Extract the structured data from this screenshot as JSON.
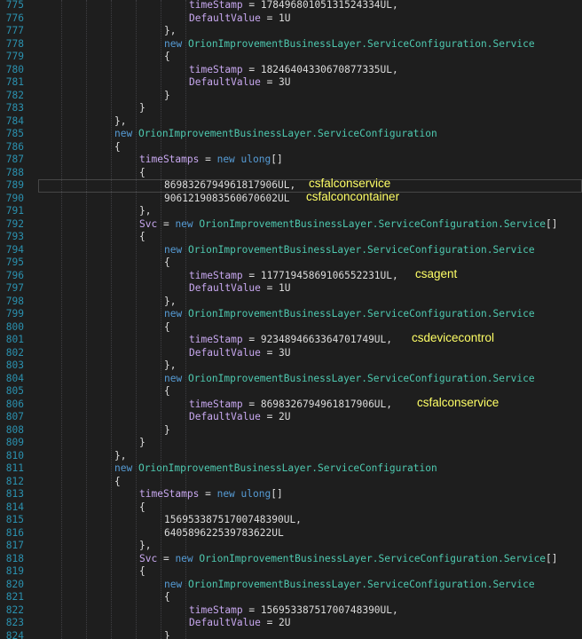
{
  "editor": {
    "lines": [
      {
        "no": "775",
        "indent": 6,
        "tokens": [
          {
            "t": "timeStamp",
            "c": "f"
          },
          {
            "t": " = 17849680105131524334UL,",
            "c": "p"
          }
        ]
      },
      {
        "no": "776",
        "indent": 6,
        "tokens": [
          {
            "t": "DefaultValue",
            "c": "f"
          },
          {
            "t": " = 1U",
            "c": "p"
          }
        ]
      },
      {
        "no": "777",
        "indent": 5,
        "tokens": [
          {
            "t": "},",
            "c": "p"
          }
        ]
      },
      {
        "no": "778",
        "indent": 5,
        "tokens": [
          {
            "t": "new ",
            "c": "k"
          },
          {
            "t": "OrionImprovementBusinessLayer.ServiceConfiguration.Service",
            "c": "t"
          }
        ]
      },
      {
        "no": "779",
        "indent": 5,
        "tokens": [
          {
            "t": "{",
            "c": "p"
          }
        ]
      },
      {
        "no": "780",
        "indent": 6,
        "tokens": [
          {
            "t": "timeStamp",
            "c": "f"
          },
          {
            "t": " = 18246404330670877335UL,",
            "c": "p"
          }
        ]
      },
      {
        "no": "781",
        "indent": 6,
        "tokens": [
          {
            "t": "DefaultValue",
            "c": "f"
          },
          {
            "t": " = 3U",
            "c": "p"
          }
        ]
      },
      {
        "no": "782",
        "indent": 5,
        "tokens": [
          {
            "t": "}",
            "c": "p"
          }
        ]
      },
      {
        "no": "783",
        "indent": 4,
        "tokens": [
          {
            "t": "}",
            "c": "p"
          }
        ]
      },
      {
        "no": "784",
        "indent": 3,
        "tokens": [
          {
            "t": "},",
            "c": "p"
          }
        ]
      },
      {
        "no": "785",
        "indent": 3,
        "tokens": [
          {
            "t": "new ",
            "c": "k"
          },
          {
            "t": "OrionImprovementBusinessLayer.ServiceConfiguration",
            "c": "t"
          }
        ]
      },
      {
        "no": "786",
        "indent": 3,
        "tokens": [
          {
            "t": "{",
            "c": "p"
          }
        ]
      },
      {
        "no": "787",
        "indent": 4,
        "tokens": [
          {
            "t": "timeStamps",
            "c": "f"
          },
          {
            "t": " = ",
            "c": "p"
          },
          {
            "t": "new ",
            "c": "k"
          },
          {
            "t": "ulong",
            "c": "k"
          },
          {
            "t": "[]",
            "c": "p"
          }
        ]
      },
      {
        "no": "788",
        "indent": 4,
        "tokens": [
          {
            "t": "{",
            "c": "p"
          }
        ]
      },
      {
        "no": "789",
        "indent": 5,
        "tokens": [
          {
            "t": "8698326794961817906UL,",
            "c": "p"
          }
        ]
      },
      {
        "no": "790",
        "indent": 5,
        "tokens": [
          {
            "t": "9061219083560670602UL",
            "c": "p"
          }
        ]
      },
      {
        "no": "791",
        "indent": 4,
        "tokens": [
          {
            "t": "},",
            "c": "p"
          }
        ]
      },
      {
        "no": "792",
        "indent": 4,
        "tokens": [
          {
            "t": "Svc",
            "c": "f"
          },
          {
            "t": " = ",
            "c": "p"
          },
          {
            "t": "new ",
            "c": "k"
          },
          {
            "t": "OrionImprovementBusinessLayer.ServiceConfiguration.Service",
            "c": "t"
          },
          {
            "t": "[]",
            "c": "p"
          }
        ]
      },
      {
        "no": "793",
        "indent": 4,
        "tokens": [
          {
            "t": "{",
            "c": "p"
          }
        ]
      },
      {
        "no": "794",
        "indent": 5,
        "tokens": [
          {
            "t": "new ",
            "c": "k"
          },
          {
            "t": "OrionImprovementBusinessLayer.ServiceConfiguration.Service",
            "c": "t"
          }
        ]
      },
      {
        "no": "795",
        "indent": 5,
        "tokens": [
          {
            "t": "{",
            "c": "p"
          }
        ]
      },
      {
        "no": "796",
        "indent": 6,
        "tokens": [
          {
            "t": "timeStamp",
            "c": "f"
          },
          {
            "t": " = 11771945869106552231UL,",
            "c": "p"
          }
        ]
      },
      {
        "no": "797",
        "indent": 6,
        "tokens": [
          {
            "t": "DefaultValue",
            "c": "f"
          },
          {
            "t": " = 1U",
            "c": "p"
          }
        ]
      },
      {
        "no": "798",
        "indent": 5,
        "tokens": [
          {
            "t": "},",
            "c": "p"
          }
        ]
      },
      {
        "no": "799",
        "indent": 5,
        "tokens": [
          {
            "t": "new ",
            "c": "k"
          },
          {
            "t": "OrionImprovementBusinessLayer.ServiceConfiguration.Service",
            "c": "t"
          }
        ]
      },
      {
        "no": "800",
        "indent": 5,
        "tokens": [
          {
            "t": "{",
            "c": "p"
          }
        ]
      },
      {
        "no": "801",
        "indent": 6,
        "tokens": [
          {
            "t": "timeStamp",
            "c": "f"
          },
          {
            "t": " = 9234894663364701749UL,",
            "c": "p"
          }
        ]
      },
      {
        "no": "802",
        "indent": 6,
        "tokens": [
          {
            "t": "DefaultValue",
            "c": "f"
          },
          {
            "t": " = 3U",
            "c": "p"
          }
        ]
      },
      {
        "no": "803",
        "indent": 5,
        "tokens": [
          {
            "t": "},",
            "c": "p"
          }
        ]
      },
      {
        "no": "804",
        "indent": 5,
        "tokens": [
          {
            "t": "new ",
            "c": "k"
          },
          {
            "t": "OrionImprovementBusinessLayer.ServiceConfiguration.Service",
            "c": "t"
          }
        ]
      },
      {
        "no": "805",
        "indent": 5,
        "tokens": [
          {
            "t": "{",
            "c": "p"
          }
        ]
      },
      {
        "no": "806",
        "indent": 6,
        "tokens": [
          {
            "t": "timeStamp",
            "c": "f"
          },
          {
            "t": " = 8698326794961817906UL,",
            "c": "p"
          }
        ]
      },
      {
        "no": "807",
        "indent": 6,
        "tokens": [
          {
            "t": "DefaultValue",
            "c": "f"
          },
          {
            "t": " = 2U",
            "c": "p"
          }
        ]
      },
      {
        "no": "808",
        "indent": 5,
        "tokens": [
          {
            "t": "}",
            "c": "p"
          }
        ]
      },
      {
        "no": "809",
        "indent": 4,
        "tokens": [
          {
            "t": "}",
            "c": "p"
          }
        ]
      },
      {
        "no": "810",
        "indent": 3,
        "tokens": [
          {
            "t": "},",
            "c": "p"
          }
        ]
      },
      {
        "no": "811",
        "indent": 3,
        "tokens": [
          {
            "t": "new ",
            "c": "k"
          },
          {
            "t": "OrionImprovementBusinessLayer.ServiceConfiguration",
            "c": "t"
          }
        ]
      },
      {
        "no": "812",
        "indent": 3,
        "tokens": [
          {
            "t": "{",
            "c": "p"
          }
        ]
      },
      {
        "no": "813",
        "indent": 4,
        "tokens": [
          {
            "t": "timeStamps",
            "c": "f"
          },
          {
            "t": " = ",
            "c": "p"
          },
          {
            "t": "new ",
            "c": "k"
          },
          {
            "t": "ulong",
            "c": "k"
          },
          {
            "t": "[]",
            "c": "p"
          }
        ]
      },
      {
        "no": "814",
        "indent": 4,
        "tokens": [
          {
            "t": "{",
            "c": "p"
          }
        ]
      },
      {
        "no": "815",
        "indent": 5,
        "tokens": [
          {
            "t": "15695338751700748390UL,",
            "c": "p"
          }
        ]
      },
      {
        "no": "816",
        "indent": 5,
        "tokens": [
          {
            "t": "640589622539783622UL",
            "c": "p"
          }
        ]
      },
      {
        "no": "817",
        "indent": 4,
        "tokens": [
          {
            "t": "},",
            "c": "p"
          }
        ]
      },
      {
        "no": "818",
        "indent": 4,
        "tokens": [
          {
            "t": "Svc",
            "c": "f"
          },
          {
            "t": " = ",
            "c": "p"
          },
          {
            "t": "new ",
            "c": "k"
          },
          {
            "t": "OrionImprovementBusinessLayer.ServiceConfiguration.Service",
            "c": "t"
          },
          {
            "t": "[]",
            "c": "p"
          }
        ]
      },
      {
        "no": "819",
        "indent": 4,
        "tokens": [
          {
            "t": "{",
            "c": "p"
          }
        ]
      },
      {
        "no": "820",
        "indent": 5,
        "tokens": [
          {
            "t": "new ",
            "c": "k"
          },
          {
            "t": "OrionImprovementBusinessLayer.ServiceConfiguration.Service",
            "c": "t"
          }
        ]
      },
      {
        "no": "821",
        "indent": 5,
        "tokens": [
          {
            "t": "{",
            "c": "p"
          }
        ]
      },
      {
        "no": "822",
        "indent": 6,
        "tokens": [
          {
            "t": "timeStamp",
            "c": "f"
          },
          {
            "t": " = 15695338751700748390UL,",
            "c": "p"
          }
        ]
      },
      {
        "no": "823",
        "indent": 6,
        "tokens": [
          {
            "t": "DefaultValue",
            "c": "f"
          },
          {
            "t": " = 2U",
            "c": "p"
          }
        ]
      },
      {
        "no": "824",
        "indent": 5,
        "tokens": [
          {
            "t": "}",
            "c": "p"
          }
        ]
      }
    ],
    "annotations": [
      {
        "line": "789",
        "text": "csfalconservice"
      },
      {
        "line": "790",
        "text": "csfalconcontainer"
      },
      {
        "line": "796",
        "text": "csagent"
      },
      {
        "line": "801",
        "text": "csdevicecontrol"
      },
      {
        "line": "806",
        "text": "csfalconservice"
      }
    ],
    "highlighted_line": "789",
    "colors": {
      "background": "#1e1e1e",
      "line_number": "#2b91af",
      "keyword": "#569cd6",
      "type": "#4ec9b0",
      "member": "#c8a8f0",
      "annotation": "#ffff66"
    }
  }
}
